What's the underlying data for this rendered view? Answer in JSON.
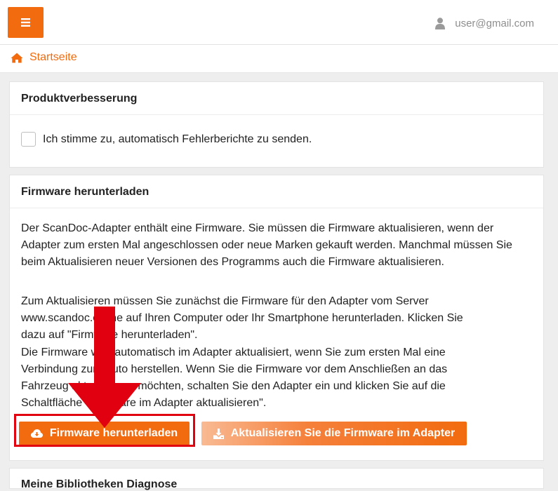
{
  "topbar": {
    "menu_icon": "hamburger-icon",
    "user_icon": "user-icon",
    "user_email": "user@gmail.com"
  },
  "breadcrumb": {
    "home_icon": "home-icon",
    "label": "Startseite"
  },
  "product_improvement": {
    "title": "Produktverbesserung",
    "consent_label": "Ich stimme zu, automatisch Fehlerberichte zu senden.",
    "consent_checked": false
  },
  "firmware": {
    "title": "Firmware herunterladen",
    "paragraph1": "Der ScanDoc-Adapter enthält eine Firmware. Sie müssen die Firmware aktualisieren, wenn der Adapter zum ersten Mal angeschlossen oder neue Marken gekauft werden. Manchmal müssen Sie beim Aktualisieren neuer Versionen des Programms auch die Firmware aktualisieren.",
    "paragraph2_lines": [
      "Zum Aktualisieren müssen Sie zunächst die Firmware für den Adapter vom Server",
      "www.scandoc.online auf Ihren Computer oder Ihr Smartphone herunterladen. Klicken Sie",
      "dazu auf \"Firmware herunterladen\".",
      "Die Firmware wird automatisch im Adapter aktualisiert, wenn Sie zum ersten Mal eine",
      "Verbindung zum Auto herstellen. Wenn Sie die Firmware vor dem Anschließen an das",
      "Fahrzeug aktualisieren möchten, schalten Sie den Adapter ein und klicken Sie auf die",
      "Schaltfläche \"Firmware im Adapter aktualisieren\"."
    ],
    "download_button": "Firmware herunterladen",
    "download_icon": "cloud-download-icon",
    "update_button": "Aktualisieren Sie die Firmware im Adapter",
    "update_icon": "download-tray-icon"
  },
  "next_section": {
    "title": "Meine Bibliotheken Diagnose"
  },
  "colors": {
    "accent": "#f26b0f",
    "highlight": "#e1000f"
  }
}
